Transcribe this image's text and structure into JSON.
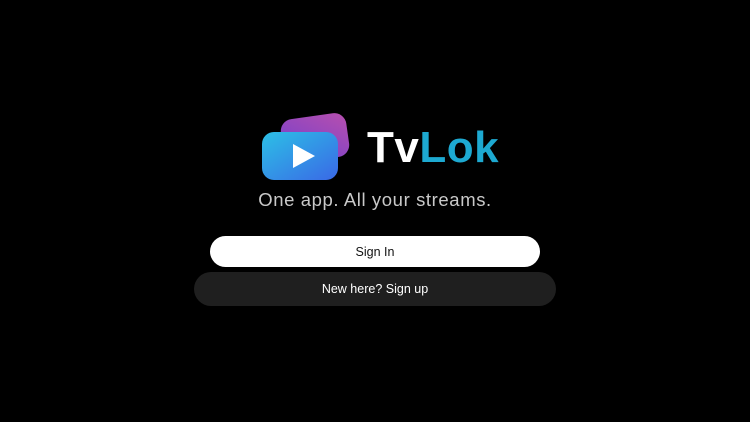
{
  "app": {
    "name_part1": "Tv",
    "name_part2": "Lok",
    "tagline": "One app. All your streams."
  },
  "logo": {
    "icon": "play-cards-icon",
    "front_gradient": [
      "#2bb7e2",
      "#3a6ee8"
    ],
    "back_gradient": [
      "#7a3fd0",
      "#b84fb0"
    ]
  },
  "actions": {
    "sign_in_label": "Sign In",
    "sign_up_label": "New here? Sign up"
  },
  "colors": {
    "background": "#000000",
    "accent": "#1da9d1",
    "primary_button": "#ffffff",
    "secondary_button": "#1f1f1f"
  }
}
